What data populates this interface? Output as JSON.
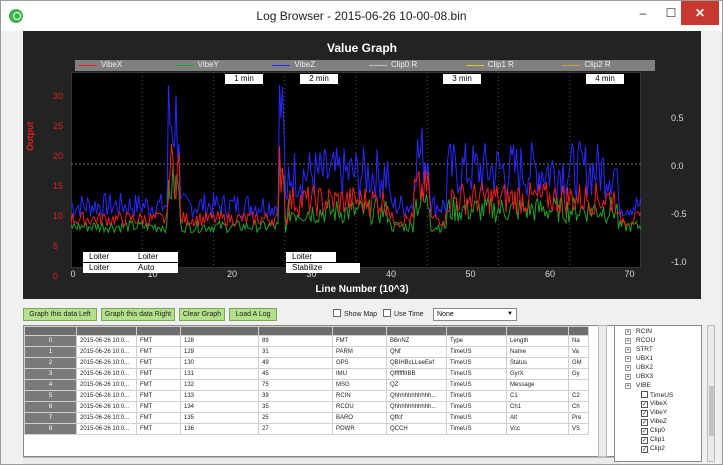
{
  "window": {
    "title": "Log Browser - 2015-06-26 10-00-08.bin"
  },
  "graph": {
    "title": "Value Graph",
    "xlabel": "Line Number (10^3)",
    "ylabel": "Output",
    "legend": [
      {
        "name": "VibeX",
        "color": "#e82020"
      },
      {
        "name": "VibeY",
        "color": "#22a02a"
      },
      {
        "name": "VibeZ",
        "color": "#2a2aff"
      },
      {
        "name": "Clip0 R",
        "color": "#bfbfbf"
      },
      {
        "name": "Clip1 R",
        "color": "#d8c83a"
      },
      {
        "name": "Clip2 R",
        "color": "#c8a040"
      }
    ],
    "yticks_left": [
      "30",
      "25",
      "20",
      "15",
      "10",
      "5",
      "0"
    ],
    "yticks_right": [
      "0.5",
      "0.0",
      "-0.5",
      "-1.0"
    ],
    "xticks": [
      "0",
      "10",
      "20",
      "30",
      "40",
      "50",
      "60",
      "70"
    ],
    "minute_markers": [
      "1 min",
      "2 min",
      "3 min",
      "4 min"
    ],
    "modes": [
      "Loiter",
      "Loiter",
      "Loiter",
      "Loiter",
      "Auto",
      "Stabilize"
    ]
  },
  "toolbar": {
    "graph_left": "Graph this data Left",
    "graph_right": "Graph this data Right",
    "clear": "Clear Graph",
    "load": "Load A Log",
    "show_map": "Show Map",
    "use_time": "Use Time",
    "select_value": "None"
  },
  "table": {
    "rows": [
      [
        "0",
        "2015-06-26 10:0...",
        "FMT",
        "128",
        "89",
        "FMT",
        "BBnNZ",
        "Type",
        "Length",
        "Na"
      ],
      [
        "1",
        "2015-06-26 10:0...",
        "FMT",
        "129",
        "31",
        "PARM",
        "QNf",
        "TimeUS",
        "Name",
        "Va"
      ],
      [
        "2",
        "2015-06-26 10:0...",
        "FMT",
        "130",
        "49",
        "GPS",
        "QBIHBcLLeeEef",
        "TimeUS",
        "Status",
        "GM"
      ],
      [
        "3",
        "2015-06-26 10:0...",
        "FMT",
        "131",
        "45",
        "IMU",
        "QffffffIIBB",
        "TimeUS",
        "GyrX",
        "Gy"
      ],
      [
        "4",
        "2015-06-26 10:0...",
        "FMT",
        "132",
        "75",
        "MSG",
        "QZ",
        "TimeUS",
        "Message",
        ""
      ],
      [
        "5",
        "2015-06-26 10:0...",
        "FMT",
        "133",
        "39",
        "RCIN",
        "Qhhhhhhhhhhh...",
        "TimeUS",
        "C1",
        "C2"
      ],
      [
        "6",
        "2015-06-26 10:0...",
        "FMT",
        "134",
        "35",
        "RCOU",
        "Qhhhhhhhhhhh...",
        "TimeUS",
        "Ch1",
        "Ch"
      ],
      [
        "7",
        "2015-06-26 10:0...",
        "FMT",
        "135",
        "25",
        "BARO",
        "Qffcf",
        "TimeUS",
        "Alt",
        "Pre"
      ],
      [
        "8",
        "2015-06-26 10:0...",
        "FMT",
        "136",
        "27",
        "POWR",
        "QCCH",
        "TimeUS",
        "Vcc",
        "VS"
      ]
    ]
  },
  "tree": {
    "items": [
      {
        "label": "RCIN",
        "type": "group"
      },
      {
        "label": "RCOU",
        "type": "group"
      },
      {
        "label": "STRT",
        "type": "group"
      },
      {
        "label": "UBX1",
        "type": "group"
      },
      {
        "label": "UBX2",
        "type": "group"
      },
      {
        "label": "UBX3",
        "type": "group"
      },
      {
        "label": "VIBE",
        "type": "group"
      },
      {
        "label": "TimeUS",
        "type": "check",
        "checked": false
      },
      {
        "label": "VibeX",
        "type": "check",
        "checked": true
      },
      {
        "label": "VibeY",
        "type": "check",
        "checked": true
      },
      {
        "label": "VibeZ",
        "type": "check",
        "checked": true
      },
      {
        "label": "Clip0",
        "type": "check",
        "checked": true
      },
      {
        "label": "Clip1",
        "type": "check",
        "checked": true
      },
      {
        "label": "Clip2",
        "type": "check",
        "checked": true
      }
    ]
  }
}
